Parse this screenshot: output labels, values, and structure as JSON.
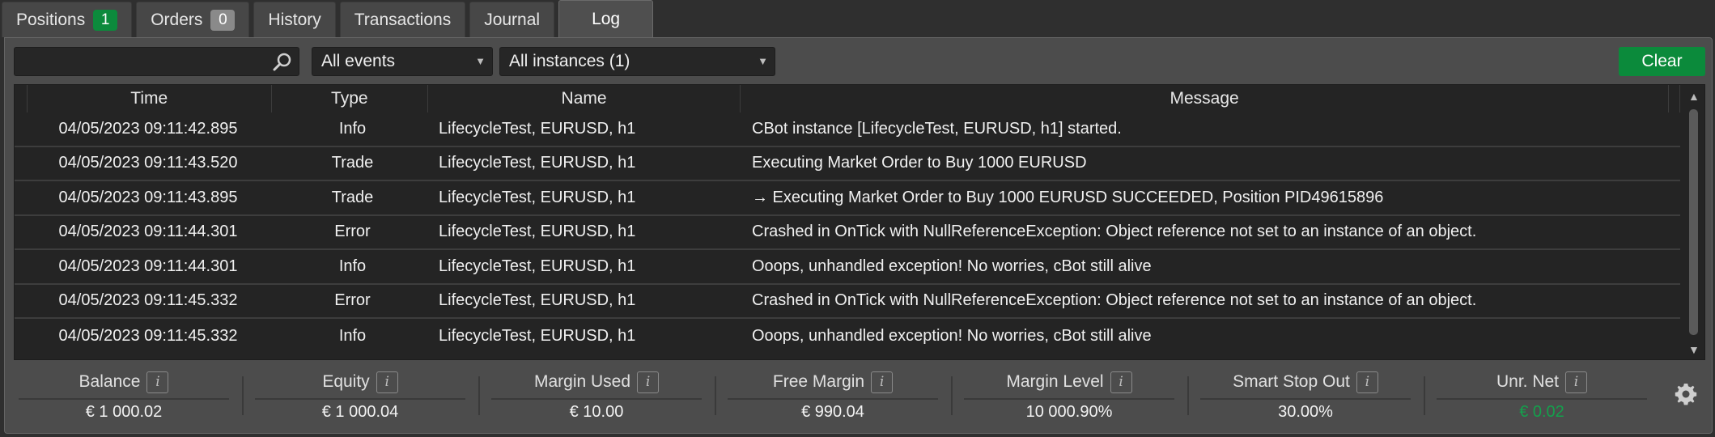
{
  "tabs": [
    {
      "label": "Positions",
      "badge": "1"
    },
    {
      "label": "Orders",
      "badge": "0"
    },
    {
      "label": "History"
    },
    {
      "label": "Transactions"
    },
    {
      "label": "Journal"
    },
    {
      "label": "Log"
    }
  ],
  "colors": {
    "accent_green": "#0b8a3b",
    "positive_value": "#14a04c"
  },
  "toolbar": {
    "search_value": "",
    "search_placeholder": "",
    "events_filter": "All events",
    "instances_filter": "All instances (1)",
    "clear_label": "Clear"
  },
  "grid": {
    "columns": [
      "Time",
      "Type",
      "Name",
      "Message"
    ],
    "rows": [
      {
        "time": "04/05/2023 09:11:42.895",
        "type": "Info",
        "name": "LifecycleTest, EURUSD, h1",
        "message": "CBot instance [LifecycleTest, EURUSD, h1] started."
      },
      {
        "time": "04/05/2023 09:11:43.520",
        "type": "Trade",
        "name": "LifecycleTest, EURUSD, h1",
        "message": "Executing Market Order to Buy 1000 EURUSD"
      },
      {
        "time": "04/05/2023 09:11:43.895",
        "type": "Trade",
        "name": "LifecycleTest, EURUSD, h1",
        "message": "→ Executing Market Order to Buy 1000 EURUSD SUCCEEDED, Position PID49615896"
      },
      {
        "time": "04/05/2023 09:11:44.301",
        "type": "Error",
        "name": "LifecycleTest, EURUSD, h1",
        "message": "Crashed in OnTick with NullReferenceException: Object reference not set to an instance of an object."
      },
      {
        "time": "04/05/2023 09:11:44.301",
        "type": "Info",
        "name": "LifecycleTest, EURUSD, h1",
        "message": "Ooops, unhandled exception! No worries, cBot still alive"
      },
      {
        "time": "04/05/2023 09:11:45.332",
        "type": "Error",
        "name": "LifecycleTest, EURUSD, h1",
        "message": "Crashed in OnTick with NullReferenceException: Object reference not set to an instance of an object."
      },
      {
        "time": "04/05/2023 09:11:45.332",
        "type": "Info",
        "name": "LifecycleTest, EURUSD, h1",
        "message": "Ooops, unhandled exception! No worries, cBot still alive"
      }
    ]
  },
  "footer": {
    "stats": [
      {
        "label": "Balance",
        "value": "€ 1 000.02"
      },
      {
        "label": "Equity",
        "value": "€ 1 000.04"
      },
      {
        "label": "Margin Used",
        "value": "€ 10.00"
      },
      {
        "label": "Free Margin",
        "value": "€ 990.04"
      },
      {
        "label": "Margin Level",
        "value": "10 000.90%"
      },
      {
        "label": "Smart Stop Out",
        "value": "30.00%"
      },
      {
        "label": "Unr. Net",
        "value": "€ 0.02"
      }
    ],
    "info_glyph": "i"
  }
}
